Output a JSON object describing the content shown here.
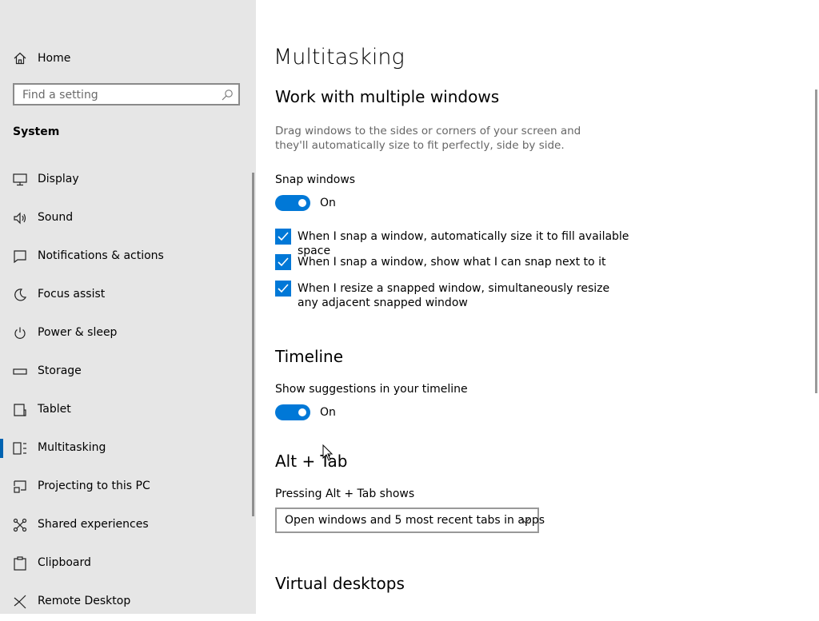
{
  "sidebar": {
    "home_label": "Home",
    "search_placeholder": "Find a setting",
    "section_title": "System",
    "items": [
      {
        "label": "Display",
        "icon": "display-icon"
      },
      {
        "label": "Sound",
        "icon": "sound-icon"
      },
      {
        "label": "Notifications & actions",
        "icon": "notifications-icon"
      },
      {
        "label": "Focus assist",
        "icon": "moon-icon"
      },
      {
        "label": "Power & sleep",
        "icon": "power-icon"
      },
      {
        "label": "Storage",
        "icon": "storage-icon"
      },
      {
        "label": "Tablet",
        "icon": "tablet-icon"
      },
      {
        "label": "Multitasking",
        "icon": "multitasking-icon",
        "active": true
      },
      {
        "label": "Projecting to this PC",
        "icon": "projecting-icon"
      },
      {
        "label": "Shared experiences",
        "icon": "shared-icon"
      },
      {
        "label": "Clipboard",
        "icon": "clipboard-icon"
      },
      {
        "label": "Remote Desktop",
        "icon": "remote-desktop-icon"
      }
    ]
  },
  "main": {
    "title": "Multitasking",
    "windows": {
      "heading": "Work with multiple windows",
      "description": "Drag windows to the sides or corners of your screen and they'll automatically size to fit perfectly, side by side.",
      "snap_label": "Snap windows",
      "snap_state": "On",
      "options": [
        {
          "label": "When I snap a window, automatically size it to fill available space",
          "checked": true
        },
        {
          "label": "When I snap a window, show what I can snap next to it",
          "checked": true
        },
        {
          "label": "When I resize a snapped window, simultaneously resize any adjacent snapped window",
          "checked": true
        }
      ]
    },
    "timeline": {
      "heading": "Timeline",
      "suggestions_label": "Show suggestions in your timeline",
      "suggestions_state": "On"
    },
    "alttab": {
      "heading": "Alt + Tab",
      "label": "Pressing Alt + Tab shows",
      "selected": "Open windows and 5 most recent tabs in apps"
    },
    "virtual": {
      "heading": "Virtual desktops"
    }
  },
  "colors": {
    "accent": "#0078d7",
    "sidebar_bg": "#e6e6e6"
  }
}
